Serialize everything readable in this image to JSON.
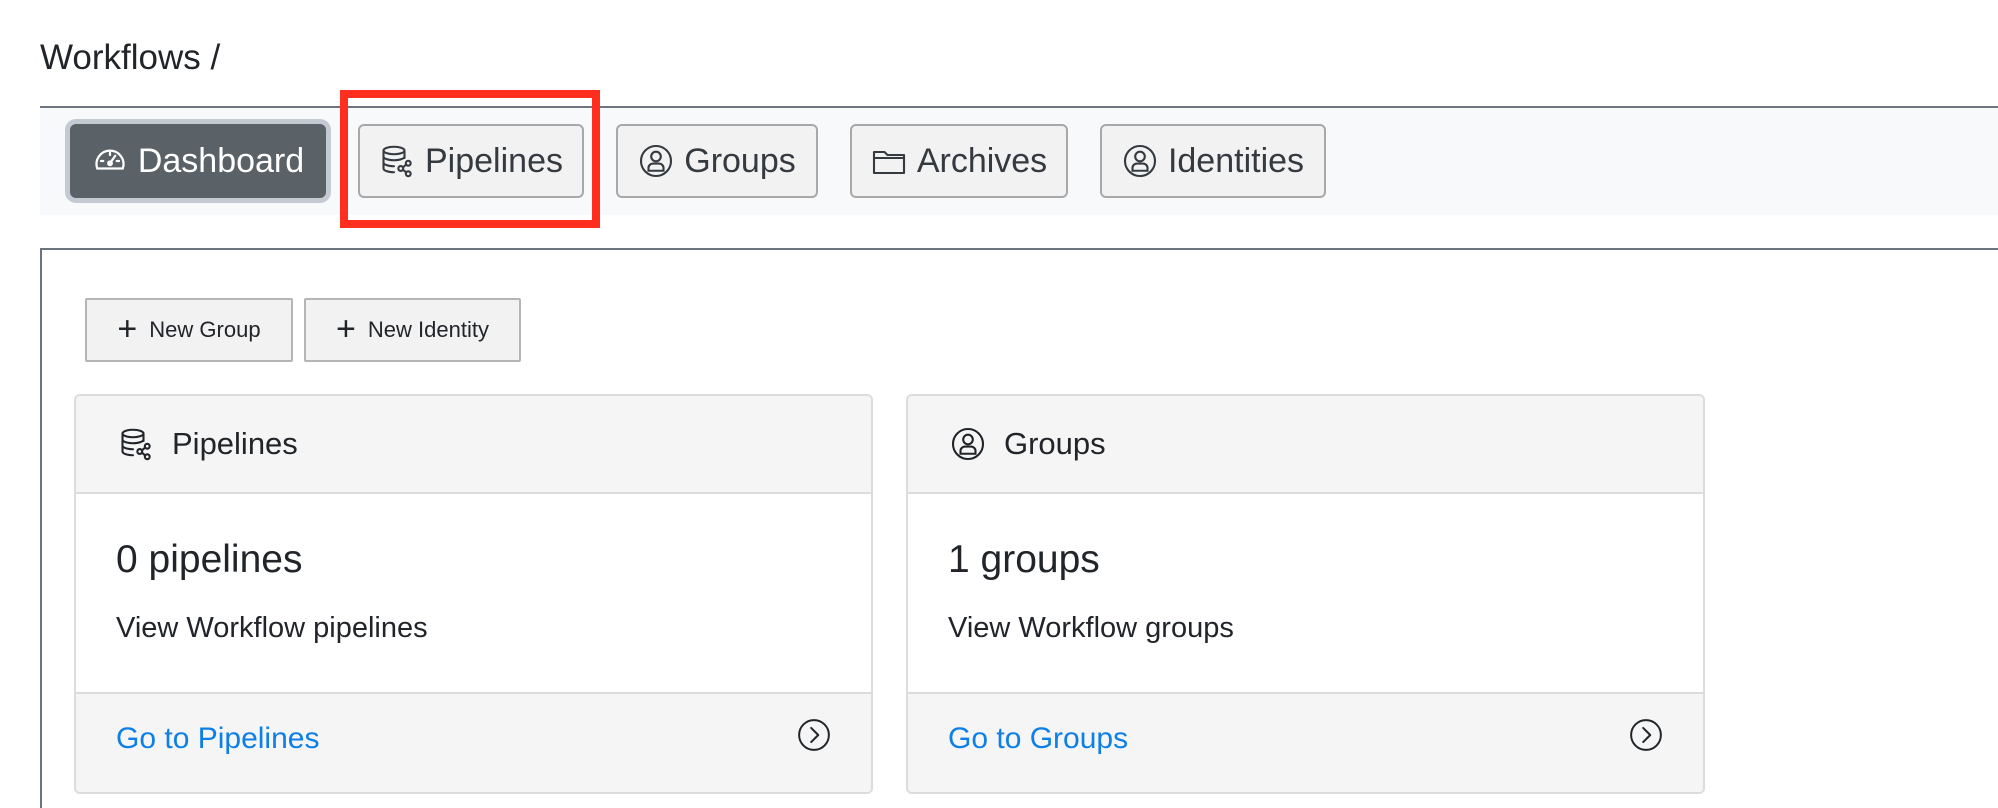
{
  "breadcrumb": {
    "text": "Workflows /"
  },
  "tabs": [
    {
      "label": "Dashboard",
      "icon": "speedometer-icon",
      "active": true
    },
    {
      "label": "Pipelines",
      "icon": "database-share-icon",
      "active": false
    },
    {
      "label": "Groups",
      "icon": "person-circle-icon",
      "active": false
    },
    {
      "label": "Archives",
      "icon": "folder-icon",
      "active": false
    },
    {
      "label": "Identities",
      "icon": "person-circle-icon",
      "active": false
    }
  ],
  "actions": {
    "new_group": "New Group",
    "new_identity": "New Identity"
  },
  "cards": [
    {
      "title": "Pipelines",
      "icon": "database-share-icon",
      "count": "0 pipelines",
      "description": "View Workflow pipelines",
      "link": "Go to Pipelines"
    },
    {
      "title": "Groups",
      "icon": "person-circle-icon",
      "count": "1 groups",
      "description": "View Workflow groups",
      "link": "Go to Groups"
    }
  ],
  "colors": {
    "active_tab": "#5a6268",
    "link": "#0d7fe6",
    "highlight": "#ff2e1f"
  }
}
